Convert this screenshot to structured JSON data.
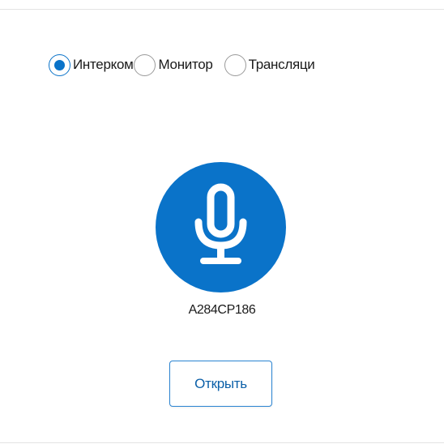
{
  "mode_selector": {
    "options": [
      {
        "label": "Интерком",
        "selected": true
      },
      {
        "label": "Монитор",
        "selected": false
      },
      {
        "label": "Трансляци",
        "selected": false
      }
    ]
  },
  "microphone": {
    "icon": "microphone-icon",
    "color": "#0a73c9"
  },
  "device": {
    "name": "А284СР186"
  },
  "actions": {
    "open_label": "Открыть"
  },
  "colors": {
    "accent": "#0a73c9",
    "button_border": "#2a84d2",
    "button_text": "#0b5fa8"
  }
}
